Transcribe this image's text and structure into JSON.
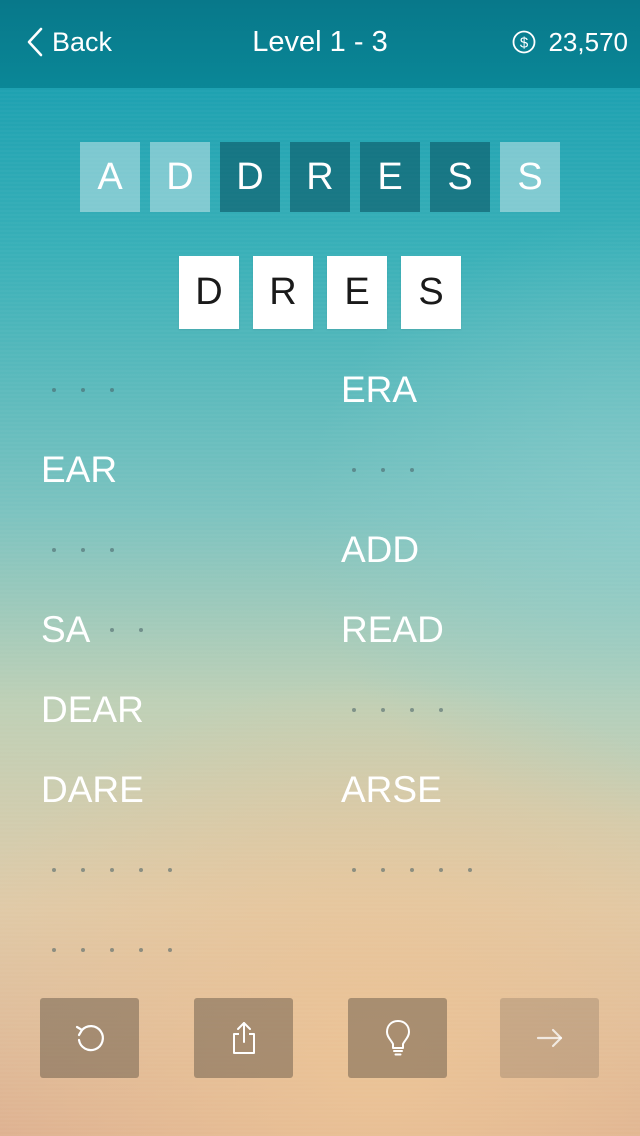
{
  "header": {
    "back_label": "Back",
    "title": "Level 1 - 3",
    "coins": "23,570"
  },
  "source_word": {
    "letters": [
      {
        "char": "A",
        "used": false
      },
      {
        "char": "D",
        "used": false
      },
      {
        "char": "D",
        "used": true
      },
      {
        "char": "R",
        "used": true
      },
      {
        "char": "E",
        "used": true
      },
      {
        "char": "S",
        "used": true
      },
      {
        "char": "S",
        "used": false
      }
    ]
  },
  "current_guess": [
    "D",
    "R",
    "E",
    "S"
  ],
  "words": {
    "left": [
      {
        "text": "",
        "length": 3
      },
      {
        "text": "EAR",
        "length": 3
      },
      {
        "text": "",
        "length": 3
      },
      {
        "text": "SA",
        "length": 4
      },
      {
        "text": "DEAR",
        "length": 4
      },
      {
        "text": "DARE",
        "length": 4
      },
      {
        "text": "",
        "length": 5
      },
      {
        "text": "",
        "length": 5
      }
    ],
    "right": [
      {
        "text": "ERA",
        "length": 3
      },
      {
        "text": "",
        "length": 3
      },
      {
        "text": "ADD",
        "length": 3
      },
      {
        "text": "READ",
        "length": 4
      },
      {
        "text": "",
        "length": 4
      },
      {
        "text": "ARSE",
        "length": 4
      },
      {
        "text": "",
        "length": 5
      }
    ]
  },
  "toolbar": {
    "buttons": [
      {
        "icon": "undo-icon",
        "enabled": true
      },
      {
        "icon": "share-icon",
        "enabled": true
      },
      {
        "icon": "lightbulb-icon",
        "enabled": true
      },
      {
        "icon": "arrow-right-icon",
        "enabled": false
      }
    ]
  },
  "colors": {
    "header": "#0a8797",
    "tile_dark": "#0c5868",
    "tile_light": "#c3e4e8",
    "button": "#736250"
  }
}
